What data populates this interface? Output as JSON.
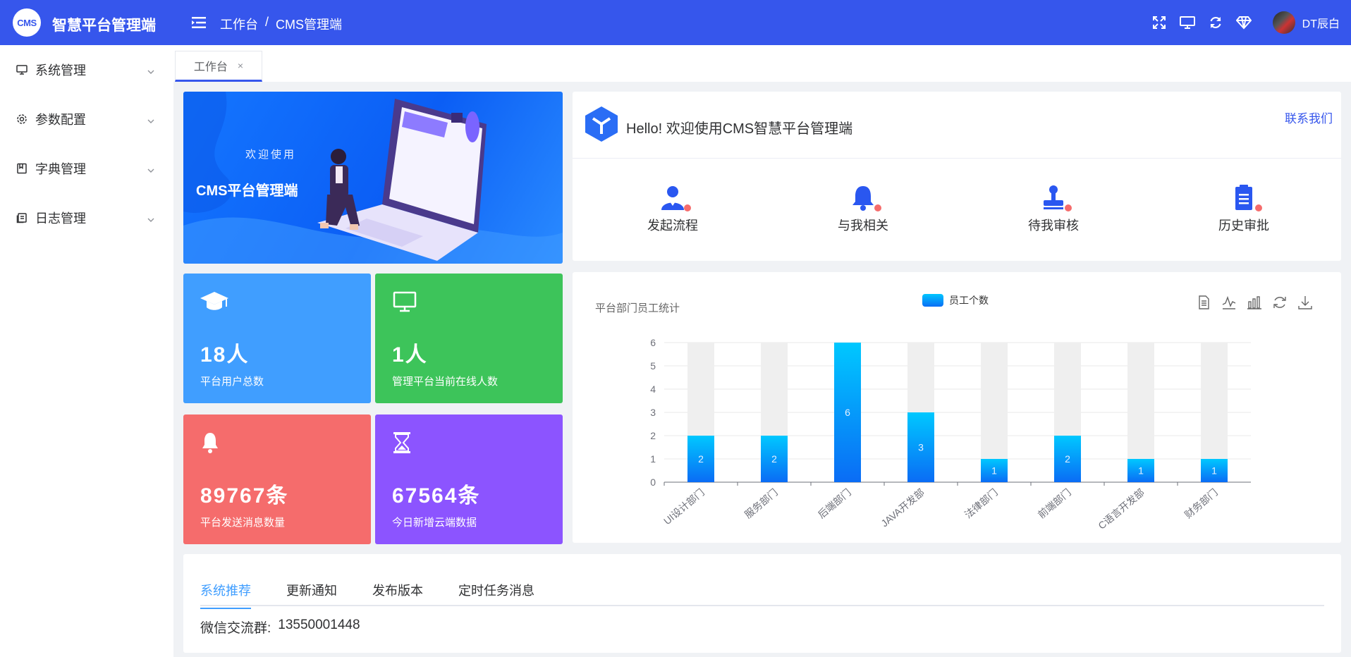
{
  "header": {
    "logo_text": "CMS",
    "app_title": "智慧平台管理端",
    "breadcrumb": [
      "工作台",
      "CMS管理端"
    ],
    "breadcrumb_sep": "/",
    "user_name": "DT辰白",
    "icons": [
      "fullscreen-icon",
      "monitor-icon",
      "refresh-icon",
      "diamond-icon"
    ]
  },
  "sidebar": {
    "items": [
      {
        "label": "系统管理",
        "icon": "monitor-icon"
      },
      {
        "label": "参数配置",
        "icon": "gear-icon"
      },
      {
        "label": "字典管理",
        "icon": "book-icon"
      },
      {
        "label": "日志管理",
        "icon": "document-icon"
      }
    ]
  },
  "tabs": [
    {
      "label": "工作台",
      "close": "×"
    }
  ],
  "banner": {
    "welcome": "欢迎使用",
    "title": "CMS平台管理端"
  },
  "welcome": {
    "hello": "Hello! 欢迎使用CMS智慧平台管理端",
    "contact": "联系我们",
    "quick": [
      {
        "label": "发起流程",
        "icon": "user-icon"
      },
      {
        "label": "与我相关",
        "icon": "bell-icon"
      },
      {
        "label": "待我审核",
        "icon": "stamp-icon"
      },
      {
        "label": "历史审批",
        "icon": "clipboard-icon"
      }
    ]
  },
  "stats": [
    {
      "value": "18人",
      "label": "平台用户总数",
      "icon": "graduation-cap-icon",
      "color": "#409eff"
    },
    {
      "value": "1人",
      "label": "管理平台当前在线人数",
      "icon": "monitor-icon",
      "color": "#3dc45a"
    },
    {
      "value": "89767条",
      "label": "平台发送消息数量",
      "icon": "bell-icon",
      "color": "#f56c6c"
    },
    {
      "value": "67564条",
      "label": "今日新增云端数据",
      "icon": "hourglass-icon",
      "color": "#8c54ff"
    }
  ],
  "chart_data": {
    "type": "bar",
    "title": "平台部门员工统计",
    "categories": [
      "UI设计部门",
      "服务部门",
      "后端部门",
      "JAVA开发部",
      "法律部门",
      "前端部门",
      "C语言开发部",
      "财务部门"
    ],
    "series": [
      {
        "name": "员工个数",
        "values": [
          2,
          2,
          6,
          3,
          1,
          2,
          1,
          1
        ]
      }
    ],
    "ylim": [
      0,
      6
    ],
    "yticks": [
      0,
      1,
      2,
      3,
      4,
      5,
      6
    ],
    "background_bars": true,
    "legend": "top-center",
    "toolbox": [
      "data-view-icon",
      "line-chart-icon",
      "bar-chart-icon",
      "restore-icon",
      "download-icon"
    ]
  },
  "news": {
    "tabs": [
      "系统推荐",
      "更新通知",
      "发布版本",
      "定时任务消息"
    ],
    "active_tab": 0,
    "content_label": "微信交流群:",
    "content_value": "13550001448"
  },
  "colors": {
    "primary": "#3656ec",
    "link": "#409eff"
  }
}
